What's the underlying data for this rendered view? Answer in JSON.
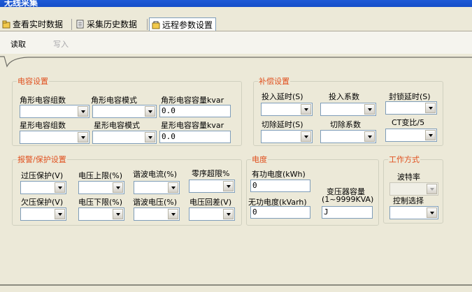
{
  "window": {
    "title": "无线采集"
  },
  "tabs": [
    {
      "label": "查看实时数据",
      "active": false
    },
    {
      "label": "采集历史数据",
      "active": false
    },
    {
      "label": "远程参数设置",
      "active": true
    }
  ],
  "toolbar": {
    "read_label": "读取",
    "write_label": "写入"
  },
  "capacitor": {
    "legend": "电容设置",
    "angle_group_label": "角形电容组数",
    "angle_mode_label": "角形电容模式",
    "angle_capacity_label": "角形电容容量kvar",
    "angle_capacity_value": "0.0",
    "star_group_label": "星形电容组数",
    "star_mode_label": "星形电容模式",
    "star_capacity_label": "星形电容容量kvar",
    "star_capacity_value": "0.0"
  },
  "compensation": {
    "legend": "补偿设置",
    "switch_in_delay_label": "投入延时(S)",
    "switch_in_coef_label": "投入系数",
    "lock_delay_label": "封锁延时(S)",
    "switch_out_delay_label": "切除延时(S)",
    "switch_out_coef_label": "切除系数",
    "ct_ratio_label": "CT变比/5"
  },
  "alarm": {
    "legend": "报警/保护设置",
    "over_voltage_label": "过压保护(V)",
    "voltage_upper_label": "电压上限(%)",
    "harmonic_current_label": "谐波电流(%)",
    "zero_seq_label": "零序超限%",
    "under_voltage_label": "欠压保护(V)",
    "voltage_lower_label": "电压下限(%)",
    "harmonic_voltage_label": "谐波电压(%)",
    "voltage_diff_label": "电压回差(V)"
  },
  "energy": {
    "legend": "电度",
    "active_label": "有功电度(kWh)",
    "active_value": "0",
    "reactive_label": "无功电度(kVarh)",
    "reactive_value": "0",
    "transformer_label_1": "变压器容量",
    "transformer_label_2": "(1~9999KVA)",
    "transformer_value": "J"
  },
  "workmode": {
    "legend": "工作方式",
    "baud_label": "波特率",
    "control_label": "控制选择"
  },
  "colors": {
    "legend": "#e0501e",
    "title_bar": "#1e5ad6",
    "background": "#ece9d8"
  },
  "icons": [
    "view-data-icon",
    "history-data-icon",
    "remote-settings-icon"
  ]
}
